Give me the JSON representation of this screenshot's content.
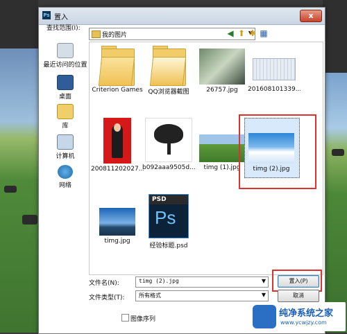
{
  "dialog": {
    "title": "置入",
    "close_label": "x",
    "look_in_label": "查找范围(I):",
    "look_in_value": "我的图片",
    "places": [
      {
        "label": "最近访问的位置"
      },
      {
        "label": "桌面"
      },
      {
        "label": "库"
      },
      {
        "label": "计算机"
      },
      {
        "label": "网络"
      }
    ],
    "files": [
      {
        "name": "Criterion Games",
        "kind": "folder"
      },
      {
        "name": "QQ浏览器截图",
        "kind": "folder"
      },
      {
        "name": "26757.jpg",
        "kind": "image"
      },
      {
        "name": "201608101339...",
        "kind": "image"
      },
      {
        "name": "200811202027...",
        "kind": "image"
      },
      {
        "name": "b092aaa9505d...",
        "kind": "image"
      },
      {
        "name": "timg (1).jpg",
        "kind": "image"
      },
      {
        "name": "timg (2).jpg",
        "kind": "image",
        "selected": true
      },
      {
        "name": "timg.jpg",
        "kind": "image"
      },
      {
        "name": "经验标题.psd",
        "kind": "psd"
      }
    ],
    "psd_icon_label": "PSD",
    "psd_icon_glyph": "Ps",
    "filename_label": "文件名(N):",
    "filename_value": "timg (2).jpg",
    "filetype_label": "文件类型(T):",
    "filetype_value": "所有格式",
    "place_button": "置入(P)",
    "cancel_button": "取消",
    "sequence_checkbox": "图像序列"
  },
  "watermark": {
    "title": "纯净系统之家",
    "url": "www.ycwjzy.com"
  },
  "colors": {
    "selection_outline": "#e03030",
    "accent": "#1a5fb4"
  }
}
